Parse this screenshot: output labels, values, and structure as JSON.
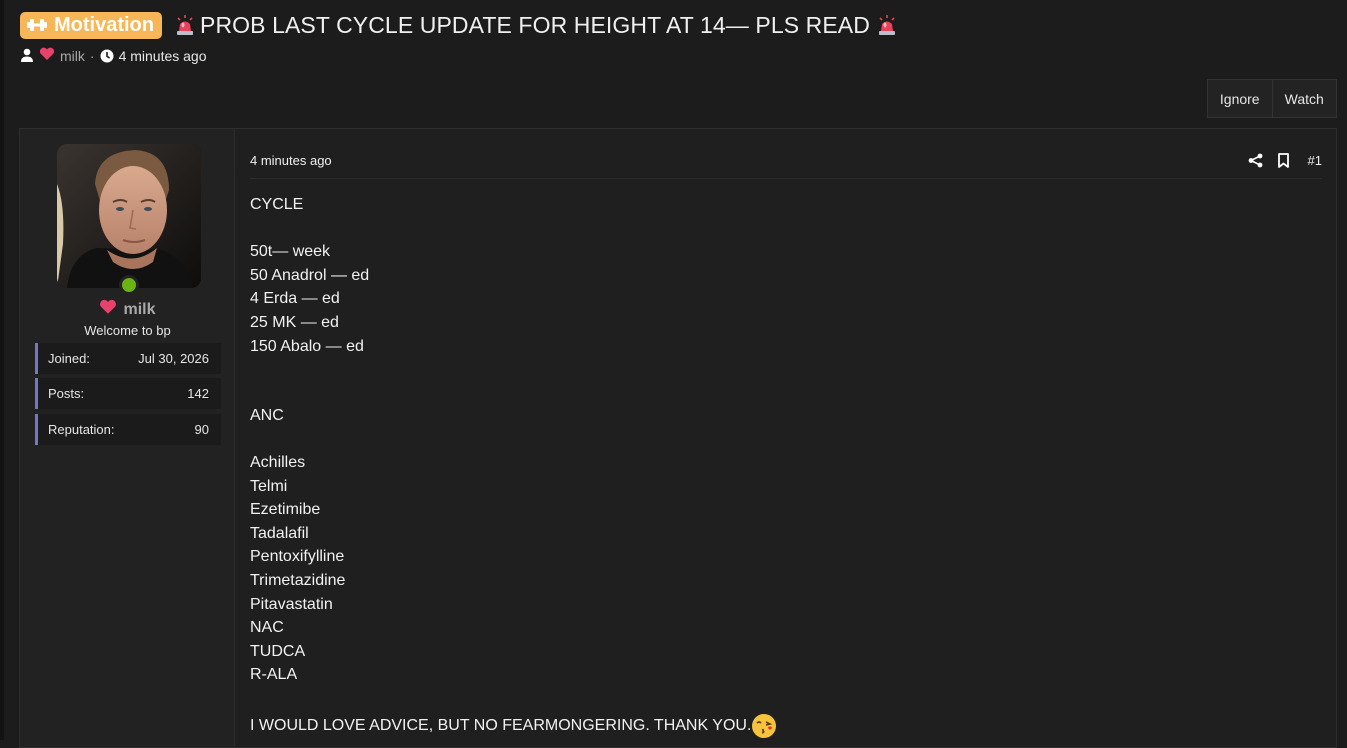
{
  "thread": {
    "prefix": "Motivation",
    "title": "PROB LAST CYCLE UPDATE FOR HEIGHT AT 14— PLS READ",
    "author": "milk",
    "separator": "·",
    "time": "4 minutes ago"
  },
  "buttons": {
    "ignore": "Ignore",
    "watch": "Watch"
  },
  "user": {
    "name": "milk",
    "title": "Welcome to bp",
    "stats": [
      {
        "label": "Joined:",
        "value": "Jul 30, 2026"
      },
      {
        "label": "Posts:",
        "value": "142"
      },
      {
        "label": "Reputation:",
        "value": "90"
      }
    ]
  },
  "post": {
    "time": "4 minutes ago",
    "number": "#1",
    "lines": {
      "heading": "CYCLE",
      "cycle": [
        "50t— week",
        "50 Anadrol — ed",
        "4 Erda — ed",
        "25 MK — ed",
        "150 Abalo — ed"
      ],
      "anc_heading": "ANC",
      "anc": [
        "Achilles",
        "Telmi",
        "Ezetimibe",
        "Tadalafil",
        "Pentoxifylline",
        "Trimetazidine",
        "Pitavastatin",
        "NAC",
        "TUDCA",
        "R-ALA"
      ],
      "closing": "I WOULD LOVE ADVICE, BUT NO FEARMONGERING. THANK YOU."
    }
  },
  "icons": {
    "prefix": "dumbbell-icon",
    "title_decoration": "siren-icon",
    "user": "user-icon",
    "heart": "heart-icon",
    "clock": "clock-icon",
    "share": "share-icon",
    "bookmark": "bookmark-icon",
    "emoji": "kissing-face-emoji"
  },
  "colors": {
    "prefix_bg": "#f7b758",
    "online": "#6bb215",
    "stat_accent": "#7676c8",
    "heart": "#e8416b",
    "background": "#1c1c1c"
  }
}
